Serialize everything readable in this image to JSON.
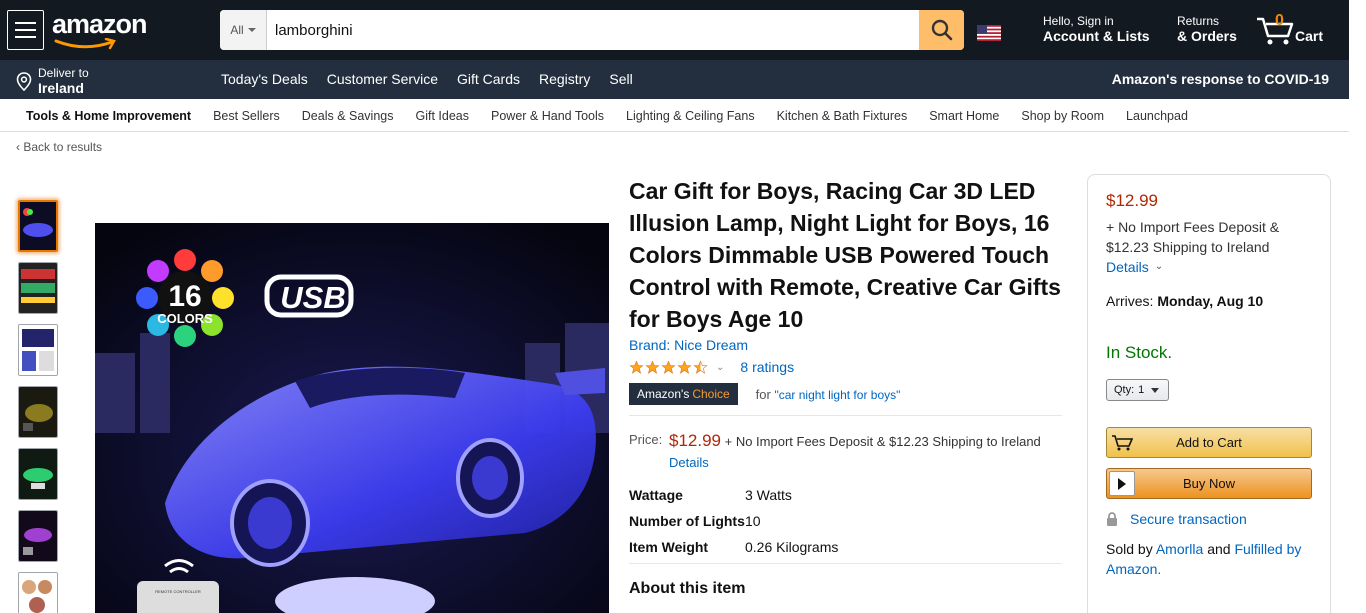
{
  "header": {
    "logo": "amazon",
    "search": {
      "category": "All",
      "query": "lamborghini"
    },
    "account": {
      "line1": "Hello, Sign in",
      "line2": "Account & Lists"
    },
    "returns": {
      "line1": "Returns",
      "line2": "& Orders"
    },
    "cart": {
      "count": "0",
      "label": "Cart"
    }
  },
  "subnav": {
    "deliver_line1": "Deliver to",
    "deliver_line2": "Ireland",
    "links": [
      "Today's Deals",
      "Customer Service",
      "Gift Cards",
      "Registry",
      "Sell"
    ],
    "covid": "Amazon's response to COVID-19"
  },
  "category_bar": {
    "main": "Tools & Home Improvement",
    "links": [
      "Best Sellers",
      "Deals & Savings",
      "Gift Ideas",
      "Power & Hand Tools",
      "Lighting & Ceiling Fans",
      "Kitchen & Bath Fixtures",
      "Smart Home",
      "Shop by Room",
      "Launchpad"
    ]
  },
  "back_link": "Back to results",
  "image_text": {
    "colors_number": "16",
    "colors_word": "COLORS",
    "usb": "USB",
    "remote": "REMOTE CONTROLLER"
  },
  "product": {
    "title": "Car Gift for Boys, Racing Car 3D LED Illusion Lamp, Night Light for Boys, 16 Colors Dimmable USB Powered Touch Control with Remote, Creative Car Gifts for Boys Age 10",
    "brand": "Brand: Nice Dream",
    "rating": 4.5,
    "ratings_count": "8 ratings",
    "choice_label": "Amazon's",
    "choice_word": "Choice",
    "choice_for": "for",
    "choice_query": "\"car night light for boys\"",
    "price_label": "Price:",
    "price": "$12.99",
    "price_fees": "+ No Import Fees Deposit & $12.23 Shipping to Ireland",
    "price_details": "Details",
    "specs": [
      {
        "key": "Wattage",
        "value": "3 Watts"
      },
      {
        "key": "Number of Lights",
        "value": "10"
      },
      {
        "key": "Item Weight",
        "value": "0.26 Kilograms"
      }
    ],
    "about": "About this item"
  },
  "buybox": {
    "price": "$12.99",
    "fees": "+ No Import Fees Deposit & $12.23 Shipping to Ireland",
    "details": "Details",
    "arrives_label": "Arrives:",
    "arrives_date": "Monday, Aug 10",
    "stock": "In Stock.",
    "qty_label": "Qty:",
    "qty_value": "1",
    "add_to_cart": "Add to Cart",
    "buy_now": "Buy Now",
    "secure": "Secure transaction",
    "sold_by_prefix": "Sold by",
    "seller": "Amorlla",
    "sold_and": "and",
    "fulfilled": "Fulfilled by Amazon."
  },
  "colors": {
    "nav_bg": "#131921",
    "subnav_bg": "#232f3e",
    "search_btn": "#febd69",
    "price_red": "#b12704",
    "link_blue": "#0066c0",
    "stock_green": "#007600",
    "cart_orange": "#f08804"
  }
}
